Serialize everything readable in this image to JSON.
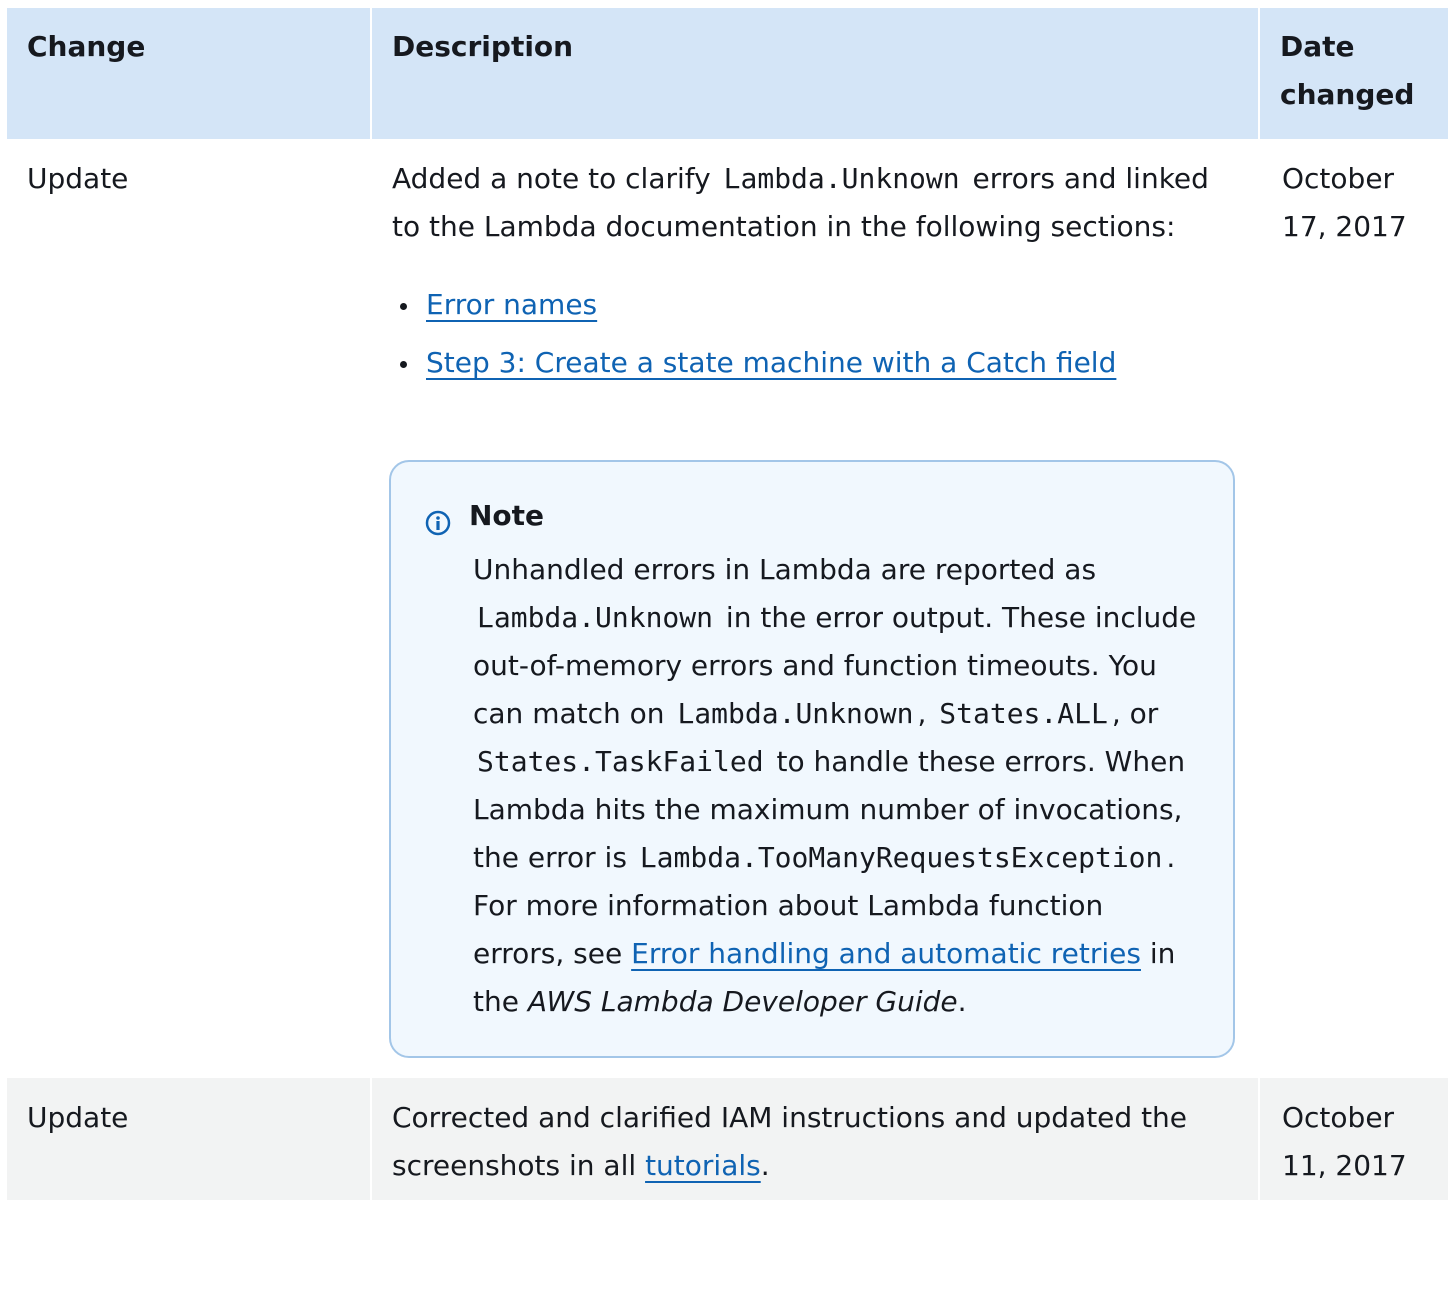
{
  "table": {
    "headers": {
      "change": "Change",
      "description": "Description",
      "date": "Date changed"
    },
    "rows": [
      {
        "change": "Update",
        "desc_intro_1": "Added a note to clarify ",
        "desc_code": "Lambda.Unknown",
        "desc_intro_2": " errors and linked to the Lambda documentation in the following sections:",
        "links": [
          "Error names",
          "Step 3: Create a state machine with a Catch field"
        ],
        "date": "October 17, 2017",
        "note": {
          "title": "Note",
          "p1": "Unhandled errors in Lambda are reported as ",
          "code1": "Lambda.Unknown",
          "p2": " in the error output. These include out-of-memory errors and function timeouts. You can match on ",
          "code2": "Lambda.Unknown",
          "p3": ", ",
          "code3": "States.ALL",
          "p4": ", or ",
          "code4": "States.TaskFailed",
          "p5": " to handle these errors. When Lambda hits the maximum number of invocations, the error is ",
          "code5": "Lambda.TooManyRequestsException",
          "p6": ". For more information about Lambda function errors, see ",
          "link": "Error handling and automatic retries",
          "p7": " in the ",
          "guide": "AWS Lambda Developer Guide",
          "p8": "."
        }
      },
      {
        "change": "Update",
        "desc_1": "Corrected and clarified IAM instructions and updated the screenshots in all ",
        "link": "tutorials",
        "desc_2": ".",
        "date": "October 11, 2017"
      }
    ]
  },
  "colors": {
    "header_bg": "#d4e5f7",
    "link": "#0f63b3",
    "note_bg": "#f1f8fe",
    "note_border": "#a3c6e8",
    "row_alt_bg": "#f2f3f3"
  },
  "icons": {
    "note_icon": "info-circle-icon"
  }
}
